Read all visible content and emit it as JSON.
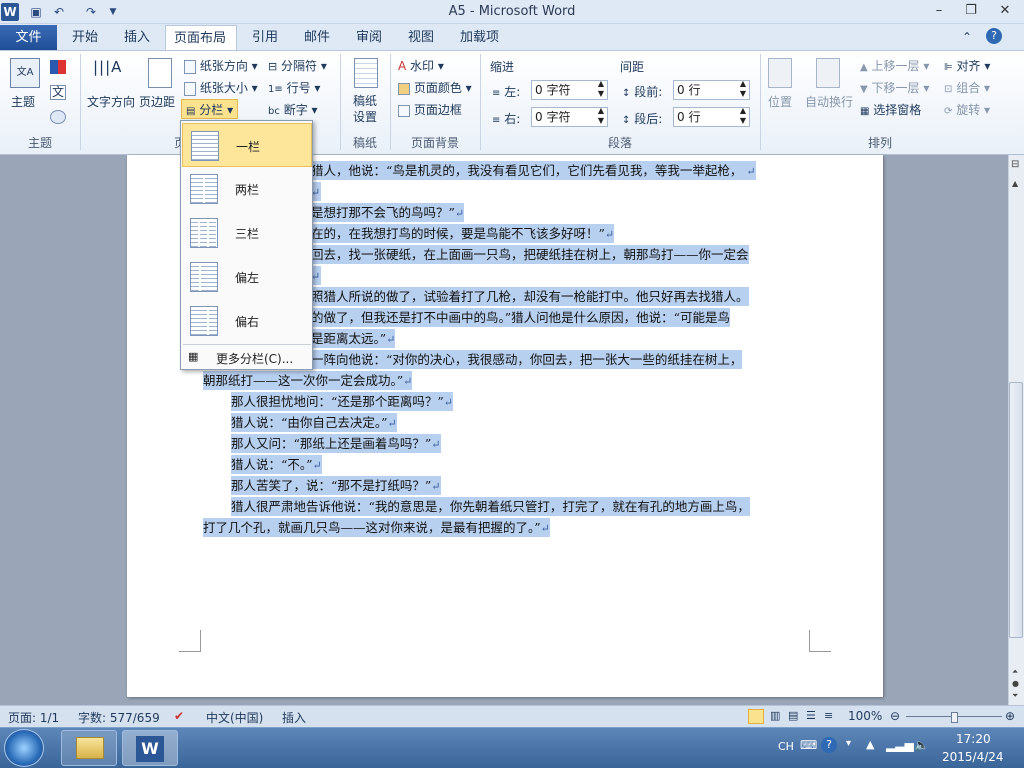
{
  "app": {
    "title": "A5 - Microsoft Word"
  },
  "qat": {
    "icons": [
      "word-logo-icon",
      "save-icon",
      "undo-icon",
      "redo-icon",
      "customize-qat-icon"
    ]
  },
  "window_controls": {
    "minimize": "–",
    "restore": "❐",
    "close": "✕"
  },
  "tabs": {
    "file": "文件",
    "home": "开始",
    "insert": "插入",
    "layout": "页面布局",
    "references": "引用",
    "mailings": "邮件",
    "review": "审阅",
    "view": "视图",
    "addins": "加载项"
  },
  "ribbon": {
    "themes": {
      "themes_btn": "主题",
      "group": "主题"
    },
    "page_setup": {
      "text_direction": "文字方向",
      "margins": "页边距",
      "orientation": "纸张方向",
      "size": "纸张大小",
      "columns": "分栏",
      "breaks": "分隔符",
      "line_numbers": "行号",
      "hyphenation": "断字",
      "group": "页"
    },
    "paper": {
      "draft": "稿纸设置",
      "draft_line1": "稿纸",
      "draft_line2": "设置",
      "group": "稿纸"
    },
    "page_bg": {
      "watermark": "水印",
      "page_color": "页面颜色",
      "page_borders": "页面边框",
      "group": "页面背景"
    },
    "paragraph": {
      "indent": "缩进",
      "spacing": "间距",
      "left_label": "左:",
      "left_value": "0 字符",
      "right_label": "右:",
      "right_value": "0 字符",
      "before_label": "段前:",
      "before_value": "0 行",
      "after_label": "段后:",
      "after_value": "0 行",
      "group": "段落"
    },
    "arrange": {
      "position": "位置",
      "wrap": "自动换行",
      "bring_forward": "上移一层",
      "send_backward": "下移一层",
      "selection_pane": "选择窗格",
      "align": "对齐",
      "group_btn": "组合",
      "rotate": "旋转",
      "group": "排列"
    }
  },
  "columns_menu": {
    "items": [
      "一栏",
      "两栏",
      "三栏",
      "偏左",
      "偏右"
    ],
    "more": "更多分栏(C)..."
  },
  "document": {
    "lines": [
      "猎人，他说：“鸟是机灵的，我没有看见它们，它们先看见我，等我一举起枪，",
      "",
      "是想打那不会飞的鸟吗？”",
      "在的，在我想打鸟的时候，要是鸟能不飞该多好呀！”",
      "回去，找一张硬纸，在上面画一只鸟，把硬纸挂在树上，朝那鸟打——你一定会",
      "",
      "照猎人所说的做了，试验着打了几枪，却没有一枪能打中。他只好再去找猎人。",
      "的做了，但我还是打不中画中的鸟。”猎人问他是什么原因，他说：“可能是鸟",
      "是距离太远。”",
      "一阵向他说：“对你的决心，我很感动，你回去，把一张大一些的纸挂在树上，",
      "朝那纸打——这一次你一定会成功。”",
      "那人很担忧地问：“还是那个距离吗？”",
      "猎人说：“由你自己去决定。”",
      "那人又问：“那纸上还是画着鸟吗？”",
      "猎人说：“不。”",
      "那人苦笑了，说：“那不是打纸吗？”",
      "猎人很严肃地告诉他说：“我的意思是，你先朝着纸只管打，打完了，就在有孔的地方画上鸟，",
      "打了几个孔，就画几只鸟——这对你来说，是最有把握的了。”"
    ]
  },
  "statusbar": {
    "page": "页面: 1/1",
    "words": "字数: 577/659",
    "language": "中文(中国)",
    "mode": "插入",
    "zoom": "100%"
  },
  "taskbar": {
    "lang": "CH",
    "time": "17:20",
    "date": "2015/4/24"
  }
}
